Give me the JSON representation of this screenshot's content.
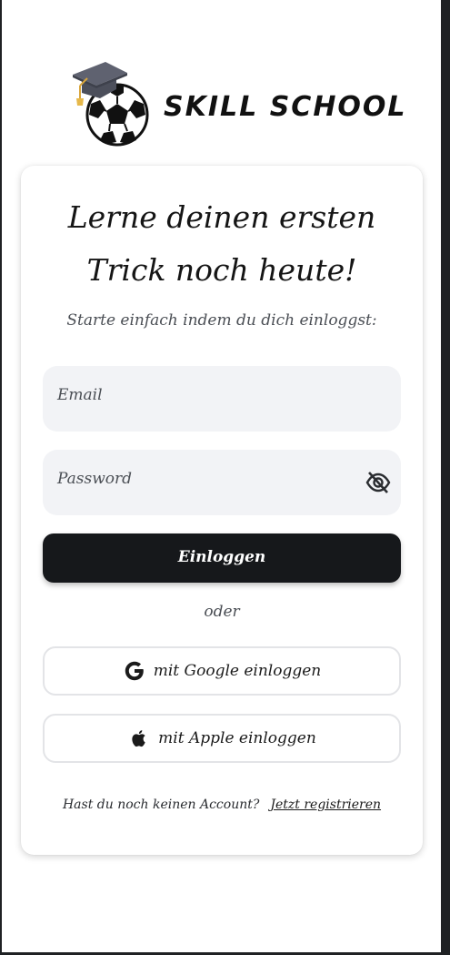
{
  "brand": {
    "name": "SKILL SCHOOL",
    "logo_icon": "graduation-cap-soccer-ball-icon"
  },
  "login": {
    "headline_line1": "Lerne deinen ersten",
    "headline_line2": "Trick noch heute!",
    "subheadline": "Starte einfach indem du dich einloggst:",
    "email_placeholder": "Email",
    "password_placeholder": "Password",
    "password_toggle_icon": "eye-off-icon",
    "submit_label": "Einloggen",
    "divider_text": "oder",
    "google_label": "mit Google einloggen",
    "google_icon": "google-icon",
    "apple_label": "mit Apple einloggen",
    "apple_icon": "apple-icon",
    "no_account_text": "Hast du noch keinen Account?",
    "register_link": "Jetzt registrieren"
  },
  "colors": {
    "primary_button": "#16181b",
    "input_background": "#f2f3f6",
    "page_background": "#ffffff"
  }
}
